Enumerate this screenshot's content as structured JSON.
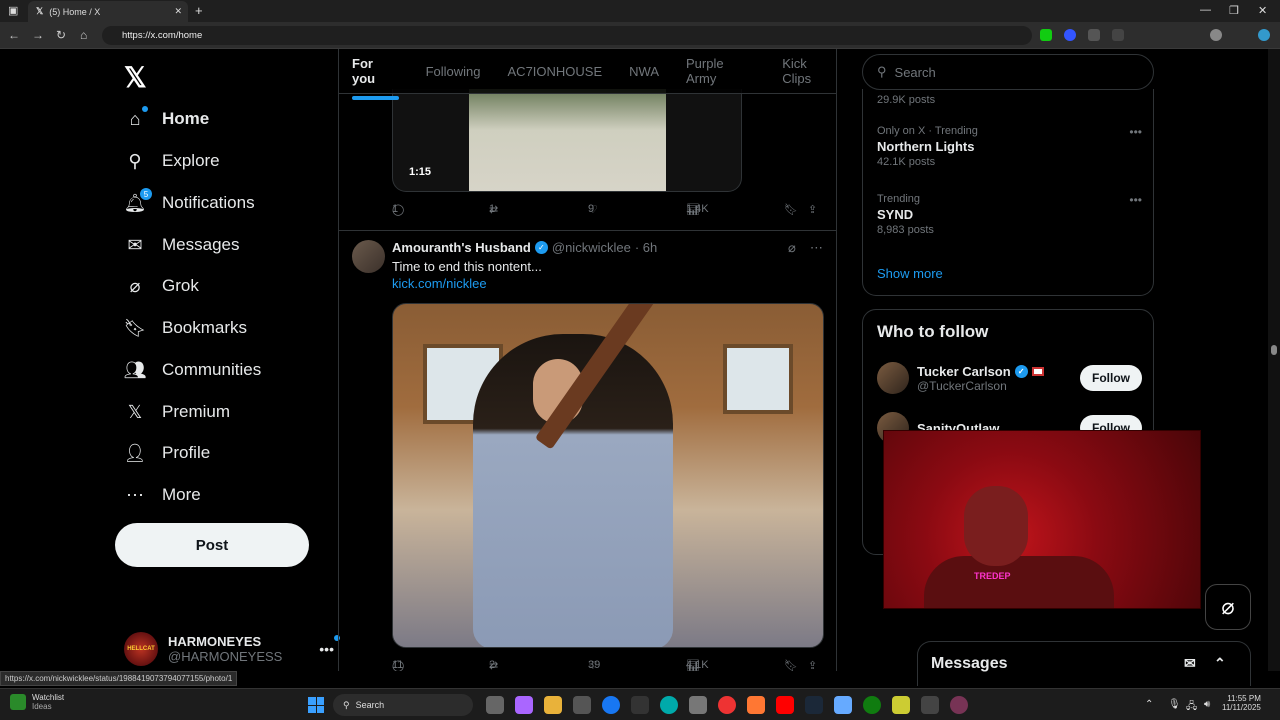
{
  "browser": {
    "tab_title": "(5) Home / X",
    "url": "https://x.com/home",
    "status_url": "https://x.com/nickwicklee/status/1988419073794077155/photo/1"
  },
  "sidebar": {
    "items": [
      {
        "label": "Home",
        "icon": "home-icon"
      },
      {
        "label": "Explore",
        "icon": "search-icon"
      },
      {
        "label": "Notifications",
        "icon": "bell-icon",
        "badge": "5"
      },
      {
        "label": "Messages",
        "icon": "mail-icon"
      },
      {
        "label": "Grok",
        "icon": "grok-icon"
      },
      {
        "label": "Bookmarks",
        "icon": "bookmark-icon"
      },
      {
        "label": "Communities",
        "icon": "people-icon"
      },
      {
        "label": "Premium",
        "icon": "x-icon"
      },
      {
        "label": "Profile",
        "icon": "person-icon"
      },
      {
        "label": "More",
        "icon": "more-circle-icon"
      }
    ],
    "post_label": "Post",
    "account": {
      "name": "HARMONEYES",
      "handle": "@HARMONEYESS",
      "avatar_text": "HELLCAT"
    }
  },
  "feed": {
    "tabs": [
      "For you",
      "Following",
      "AC7IONHOUSE",
      "NWA",
      "Purple Army",
      "Kick Clips"
    ],
    "prev_tweet": {
      "duration": "1:15",
      "replies": "1",
      "reposts": "1",
      "likes": "9",
      "views": "1.4K"
    },
    "tweet": {
      "name": "Amouranth's Husband",
      "handle": "@nickwicklee",
      "time": "· 6h",
      "text": "Time to end this nontent...",
      "link": "kick.com/nicklee",
      "replies": "11",
      "reposts": "2",
      "likes": "39",
      "views": "4.1K"
    }
  },
  "right": {
    "search_placeholder": "Search",
    "trends": [
      {
        "count": "29.9K posts"
      },
      {
        "meta": "Only on X · Trending",
        "topic": "Northern Lights",
        "count": "42.1K posts"
      },
      {
        "meta": "Trending",
        "topic": "SYND",
        "count": "8,983 posts"
      }
    ],
    "show_more": "Show more",
    "who_to_follow": {
      "title": "Who to follow",
      "accounts": [
        {
          "name": "Tucker Carlson",
          "handle": "@TuckerCarlson",
          "button": "Follow"
        },
        {
          "name": "SanityOutlaw",
          "handle": "",
          "button": "Follow"
        }
      ]
    },
    "messages_drawer": "Messages"
  },
  "webcam": {
    "shirt_text": "TREDEP"
  },
  "taskbar": {
    "watchlist": "Watchlist",
    "watchlist_sub": "Ideas",
    "search": "Search",
    "time": "11:55 PM",
    "date": "11/11/2025"
  },
  "colors": {
    "accent": "#1d9bf0",
    "bg": "#000000",
    "border": "#2f3336",
    "muted": "#71767b"
  }
}
